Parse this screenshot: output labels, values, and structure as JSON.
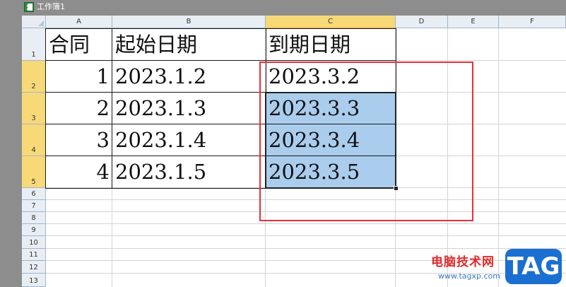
{
  "window": {
    "title": "工作簿1"
  },
  "columns": [
    "A",
    "B",
    "C",
    "D",
    "E",
    "F"
  ],
  "rows": [
    "1",
    "2",
    "3",
    "4",
    "5",
    "6",
    "7",
    "8",
    "9",
    "10",
    "11",
    "12",
    "13"
  ],
  "cells": {
    "A1": "合同",
    "B1": "起始日期",
    "C1": "到期日期",
    "A2": "1",
    "B2": "2023.1.2",
    "C2": "2023.3.2",
    "A3": "2",
    "B3": "2023.1.3",
    "C3": "2023.3.3",
    "A4": "3",
    "B4": "2023.1.4",
    "C4": "2023.3.4",
    "A5": "4",
    "B5": "2023.1.5",
    "C5": "2023.3.5"
  },
  "selection": {
    "range": "C2:C5",
    "highlight_color": "#aacdee"
  },
  "annotation": {
    "color": "#e8303a"
  },
  "watermark": {
    "site_name": "电脑技术网",
    "url": "www.tagxp.com",
    "badge": "TAG"
  },
  "icons": {
    "app_icon": "excel-icon"
  }
}
